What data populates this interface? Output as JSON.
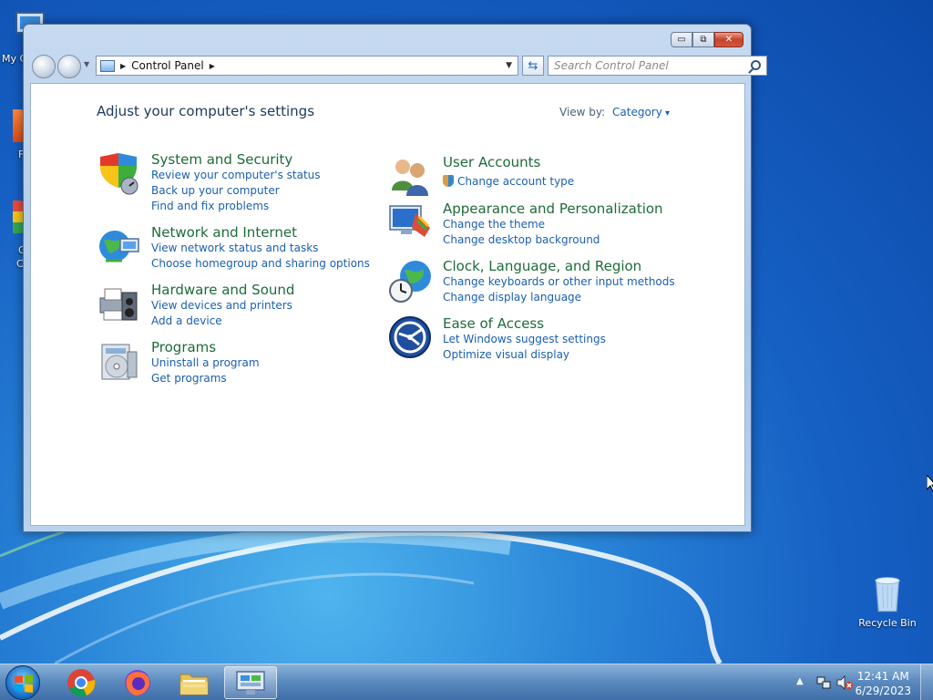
{
  "desktop": {
    "icons": {
      "my_computer": "My C",
      "recycle_bin": "Recycle Bin"
    },
    "partial_labels": [
      "F",
      "G",
      "C"
    ]
  },
  "window": {
    "caption_buttons": {
      "minimize": "▭",
      "restore": "⧉",
      "close": "✕"
    },
    "address": {
      "path": "Control Panel"
    },
    "search": {
      "placeholder": "Search Control Panel"
    },
    "title": "Adjust your computer's settings",
    "view_by": {
      "label": "View by:",
      "value": "Category"
    },
    "categories_left": [
      {
        "name": "System and Security",
        "icon": "shield-icon",
        "links": [
          "Review your computer's status",
          "Back up your computer",
          "Find and fix problems"
        ]
      },
      {
        "name": "Network and Internet",
        "icon": "globe-network-icon",
        "links": [
          "View network status and tasks",
          "Choose homegroup and sharing options"
        ]
      },
      {
        "name": "Hardware and Sound",
        "icon": "printer-speaker-icon",
        "links": [
          "View devices and printers",
          "Add a device"
        ]
      },
      {
        "name": "Programs",
        "icon": "programs-disc-icon",
        "links": [
          "Uninstall a program",
          "Get programs"
        ]
      }
    ],
    "categories_right": [
      {
        "name": "User Accounts",
        "icon": "users-icon",
        "links": [
          "Change account type"
        ]
      },
      {
        "name": "Appearance and Personalization",
        "icon": "monitor-palette-icon",
        "links": [
          "Change the theme",
          "Change desktop background"
        ]
      },
      {
        "name": "Clock, Language, and Region",
        "icon": "clock-globe-icon",
        "links": [
          "Change keyboards or other input methods",
          "Change display language"
        ]
      },
      {
        "name": "Ease of Access",
        "icon": "ease-of-access-icon",
        "links": [
          "Let Windows suggest settings",
          "Optimize visual display"
        ]
      }
    ]
  },
  "taskbar": {
    "items": [
      "start-button",
      "chrome",
      "firefox",
      "file-explorer",
      "control-panel"
    ],
    "clock": {
      "time": "12:41 AM",
      "date": "6/29/2023"
    },
    "tray_arrow": "▲"
  }
}
